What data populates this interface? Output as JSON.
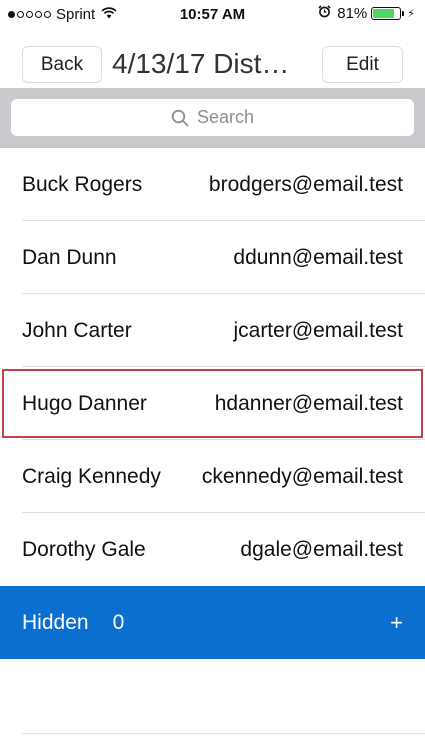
{
  "status_bar": {
    "carrier": "Sprint",
    "time": "10:57 AM",
    "battery_percent": "81%",
    "battery_level": 0.81,
    "signal_bars_filled": 1,
    "signal_bars_total": 5
  },
  "header": {
    "back_label": "Back",
    "title": "4/13/17 Dist…",
    "edit_label": "Edit"
  },
  "search": {
    "placeholder": "Search",
    "icon": "search-icon"
  },
  "contacts": [
    {
      "name": "Buck Rogers",
      "email": "brodgers@email.test"
    },
    {
      "name": "Dan Dunn",
      "email": "ddunn@email.test"
    },
    {
      "name": "John Carter",
      "email": "jcarter@email.test"
    },
    {
      "name": "Hugo Danner",
      "email": "hdanner@email.test"
    },
    {
      "name": "Craig Kennedy",
      "email": "ckennedy@email.test"
    },
    {
      "name": "Dorothy Gale",
      "email": "dgale@email.test"
    }
  ],
  "hidden": {
    "label": "Hidden",
    "count": "0",
    "add_label": "+"
  },
  "colors": {
    "accent": "#0a6fcf",
    "highlight_border": "#c0444a",
    "battery": "#4cd964",
    "search_bar_bg": "#c9c9ce"
  }
}
